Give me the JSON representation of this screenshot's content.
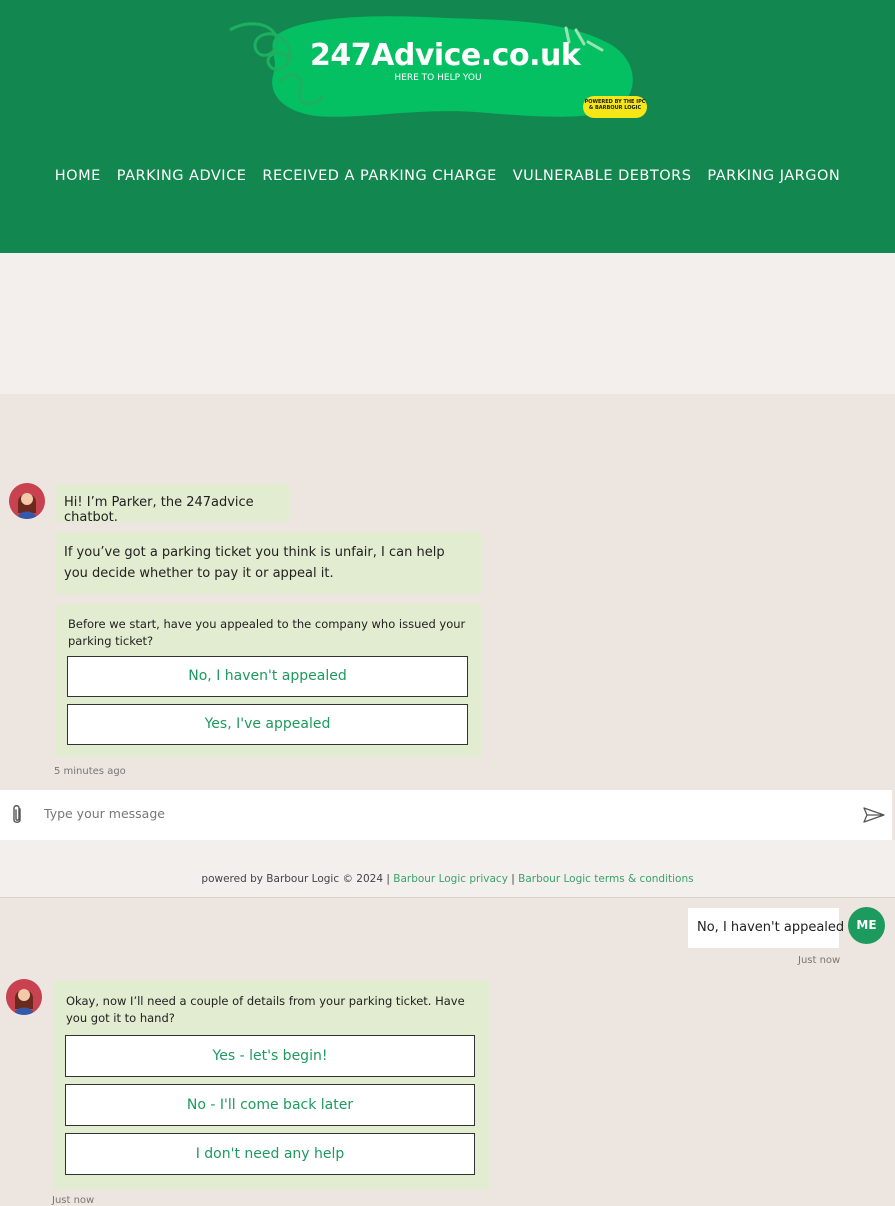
{
  "brand": {
    "title": "247Advice.co.uk",
    "tagline": "HERE TO HELP YOU",
    "badge": "POWERED BY THE IPC & BARBOUR LOGIC",
    "primary_color": "#138750",
    "accent_color": "#1d9a5e",
    "blob_color": "#04c063",
    "badge_color": "#f5e615"
  },
  "nav": {
    "items": [
      "HOME",
      "PARKING ADVICE",
      "RECEIVED A PARKING CHARGE",
      "VULNERABLE DEBTORS",
      "PARKING JARGON"
    ]
  },
  "chat": {
    "messages": [
      "Hi! I’m Parker, the 247advice chatbot.",
      "If you’ve got a parking ticket you think is unfair, I can help you decide whether to pay it or appeal it."
    ],
    "question1": "Before we start, have you appealed to the company who issued your parking ticket?",
    "options1": [
      "No, I haven't appealed",
      "Yes, I've appealed"
    ],
    "timestamp1": "5 minutes ago",
    "input_placeholder": "Type your message",
    "user_reply": "No, I haven't appealed",
    "user_avatar": "ME",
    "timestamp_user": "Just now",
    "question2": "Okay, now I’ll need a couple of details from your parking ticket. Have you got it to hand?",
    "options2": [
      "Yes - let's begin!",
      "No - I'll come back later",
      "I don't need any help"
    ],
    "timestamp2": "Just now"
  },
  "footer": {
    "text": "powered by Barbour Logic © 2024 |",
    "separator": "|",
    "privacy_link": "Barbour Logic privacy",
    "terms_link": "Barbour Logic terms & conditions"
  }
}
